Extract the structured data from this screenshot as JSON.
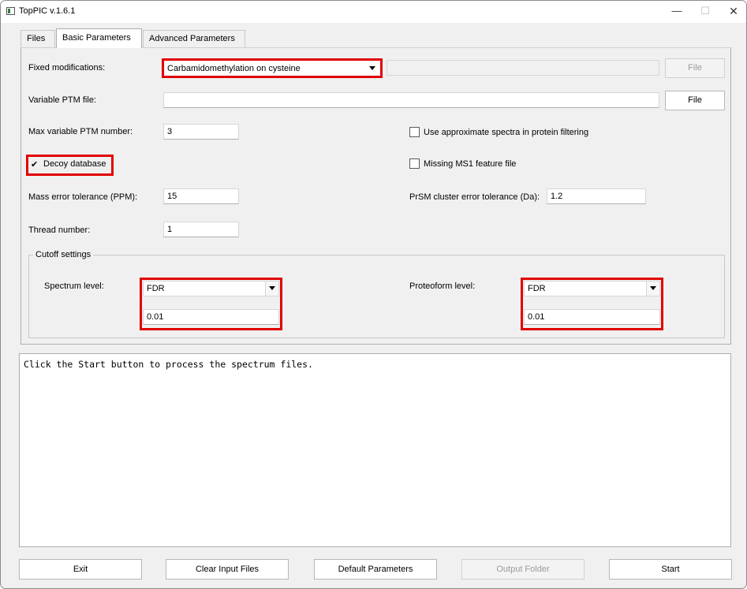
{
  "window": {
    "title": "TopPIC v.1.6.1",
    "controls": {
      "minimize": "—",
      "maximize": "☐",
      "close": "✕"
    }
  },
  "tabs": [
    {
      "label": "Files",
      "active": false
    },
    {
      "label": "Basic Parameters",
      "active": true
    },
    {
      "label": "Advanced Parameters",
      "active": false
    }
  ],
  "basic": {
    "fixed_mod_label": "Fixed modifications:",
    "fixed_mod_value": "Carbamidomethylation on cysteine",
    "fixed_mod_file_value": "",
    "fixed_mod_file_button": "File",
    "var_ptm_label": "Variable PTM file:",
    "var_ptm_value": "",
    "var_ptm_file_button": "File",
    "max_var_ptm_label": "Max variable PTM number:",
    "max_var_ptm_value": "3",
    "approx_spectra_label": "Use approximate spectra in protein filtering",
    "approx_spectra_checked": false,
    "decoy_label": "Decoy database",
    "decoy_checked": true,
    "missing_ms1_label": "Missing MS1 feature file",
    "missing_ms1_checked": false,
    "mass_error_label": "Mass error tolerance (PPM):",
    "mass_error_value": "15",
    "prsm_cluster_label": "PrSM cluster error tolerance (Da):",
    "prsm_cluster_value": "1.2",
    "thread_label": "Thread number:",
    "thread_value": "1"
  },
  "cutoff": {
    "group_title": "Cutoff settings",
    "spectrum_label": "Spectrum level:",
    "spectrum_type": "FDR",
    "spectrum_value": "0.01",
    "proteoform_label": "Proteoform level:",
    "proteoform_type": "FDR",
    "proteoform_value": "0.01"
  },
  "log": {
    "text": "Click the Start button to process the spectrum files."
  },
  "buttons": {
    "exit": "Exit",
    "clear_input_files": "Clear Input Files",
    "default_parameters": "Default Parameters",
    "output_folder": "Output Folder",
    "start": "Start"
  },
  "colors": {
    "highlight": "#e10000",
    "window_bg": "#f0f0f0"
  }
}
